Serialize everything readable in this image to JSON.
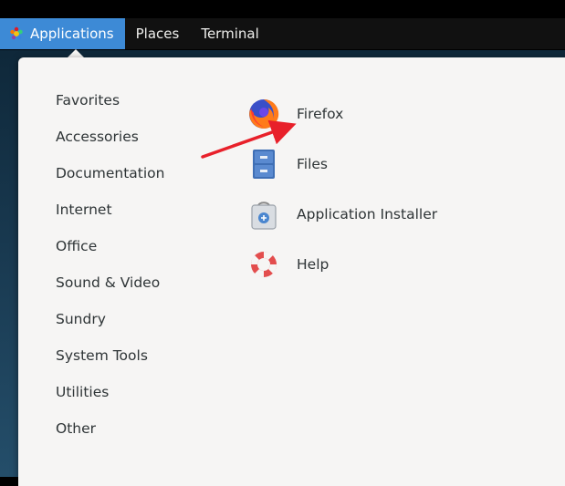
{
  "topbar": {
    "applications_label": "Applications",
    "places_label": "Places",
    "terminal_label": "Terminal"
  },
  "menu": {
    "categories": [
      "Favorites",
      "Accessories",
      "Documentation",
      "Internet",
      "Office",
      "Sound & Video",
      "Sundry",
      "System Tools",
      "Utilities",
      "Other"
    ],
    "apps": [
      {
        "label": "Firefox",
        "icon": "firefox-icon"
      },
      {
        "label": "Files",
        "icon": "files-icon"
      },
      {
        "label": "Application Installer",
        "icon": "application-installer-icon"
      },
      {
        "label": "Help",
        "icon": "help-icon"
      }
    ]
  },
  "colors": {
    "topbar_bg": "#111111",
    "active_menu_bg": "#3d8ad6",
    "menu_bg": "#f6f5f4",
    "annotation_arrow": "#e8202a"
  }
}
